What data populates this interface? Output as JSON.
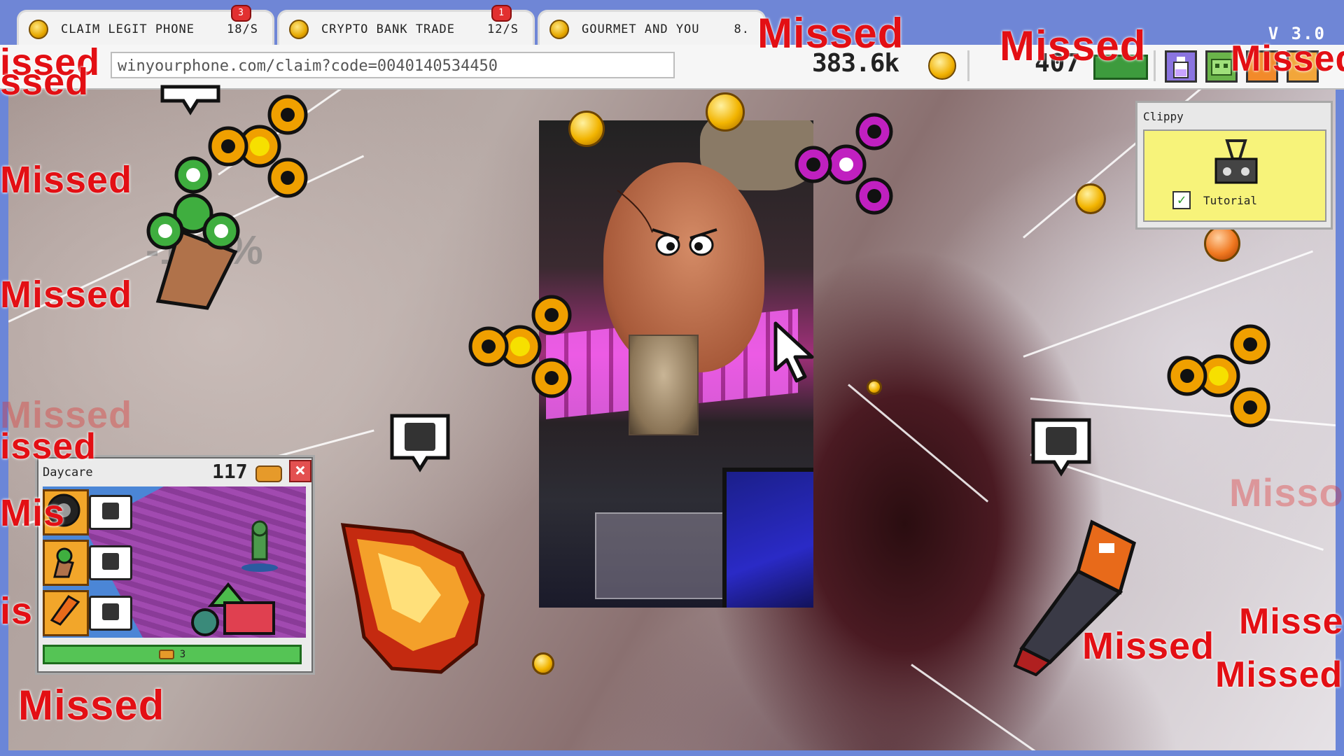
{
  "tabs": [
    {
      "label": "CLAIM LEGIT PHONE",
      "rate": "18/s",
      "badge": "3"
    },
    {
      "label": "CRYPTO BANK TRADE",
      "rate": "12/s",
      "badge": "1"
    },
    {
      "label": "GOURMET AND YOU",
      "rate": "8.",
      "badge": ""
    }
  ],
  "address": {
    "url": "winyourphone.com/claim?code=0040140534450"
  },
  "stats": {
    "coins": "383.6k",
    "cash": "407"
  },
  "version": "V 3.0",
  "overlay": {
    "percent": "-102%"
  },
  "missed_label": "Missed",
  "missed_partial": {
    "issed": "issed",
    "ssed": "ssed",
    "mis": "Mis",
    "is": "is",
    "misse": "Misse",
    "misso": "Misso",
    "issed2": "issed"
  },
  "daycare": {
    "title": "Daycare",
    "count": "117",
    "close": "×",
    "bar_value": "3"
  },
  "clippy": {
    "title": "Clippy",
    "check": "✓",
    "label": "Tutorial"
  },
  "icons": {
    "tab_coin": "coin-icon",
    "money_coin": "coin-icon",
    "cash": "cash-icon",
    "bottle": "bottle-icon",
    "robot": "robot-icon",
    "spinner": "fidget-spinner-icon",
    "pin": "map-pin-icon",
    "clip": "binder-clip-icon",
    "cursor": "cursor-arrow-icon",
    "flashlight": "flashlight-icon",
    "meteor": "fireball-icon"
  },
  "colors": {
    "missed": "#e30f14",
    "spinner_orange": "#f0a000",
    "spinner_pink": "#c020c0",
    "spinner_green": "#3fae3f",
    "chrome_blue": "#6f86d6"
  }
}
